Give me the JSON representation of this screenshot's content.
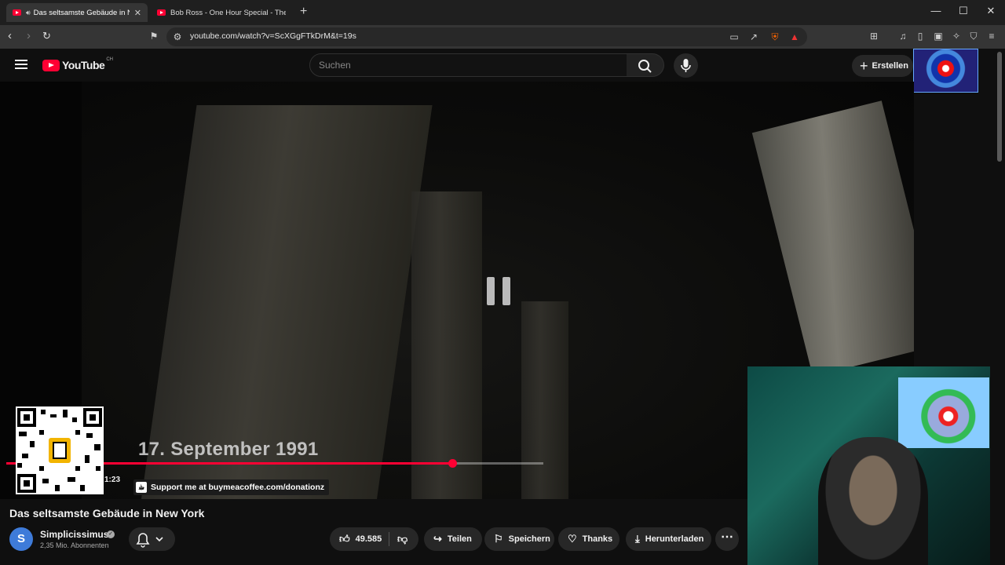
{
  "browser": {
    "tabs": [
      {
        "title": "Das seltsamste Gebäude in N",
        "active": true
      },
      {
        "title": "Bob Ross - One Hour Special - The G",
        "active": false
      }
    ],
    "new_tab_label": "+",
    "url": "youtube.com/watch?v=ScXGgFTkDrM&t=19s",
    "window_controls": {
      "minimize": "—",
      "maximize": "☐",
      "close": "✕"
    }
  },
  "masthead": {
    "logo": "YouTube",
    "country_code": "CH",
    "search_placeholder": "Suchen",
    "create_label": "Erstellen"
  },
  "player": {
    "overlay_date": "17. September 1991",
    "time": "1:23",
    "support_text": "Support me at buymeacoffee.com/donationz",
    "progress_fraction": 0.83,
    "state": "paused"
  },
  "video": {
    "title": "Das seltsamste Gebäude in New York",
    "channel": {
      "name": "Simplicissimus",
      "avatar_letter": "S",
      "subscribers": "2,35 Mio. Abonnenten"
    },
    "actions": {
      "likes": "49.585",
      "share": "Teilen",
      "save": "Speichern",
      "thanks": "Thanks",
      "download": "Herunterladen",
      "more": "⋯"
    }
  },
  "colors": {
    "accent": "#ff0033",
    "background": "#0f0f0f",
    "chip": "#272727"
  }
}
